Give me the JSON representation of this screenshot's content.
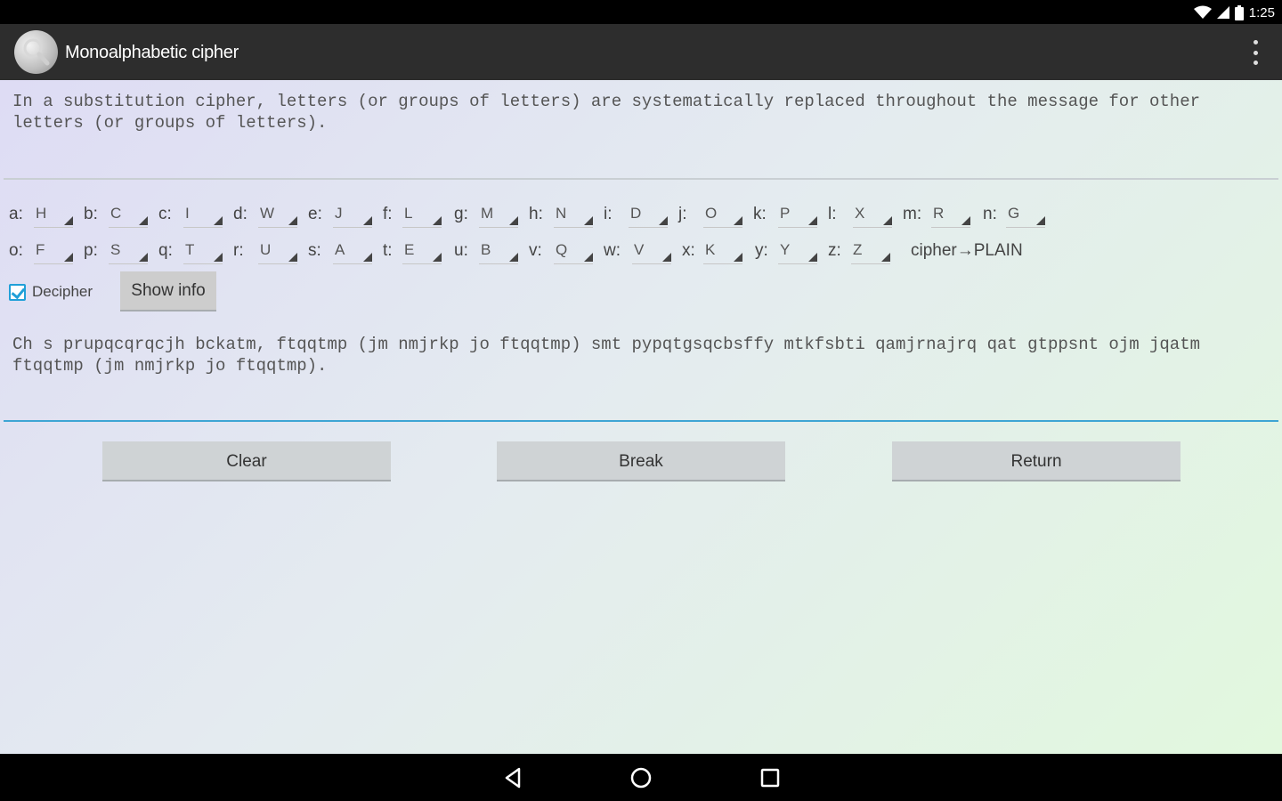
{
  "status_bar": {
    "time": "1:25"
  },
  "app": {
    "title": "Monoalphabetic cipher"
  },
  "info_text": "In a substitution cipher, letters (or groups of letters) are systematically replaced throughout the message for other letters (or groups of letters).",
  "mapping": {
    "row1": [
      {
        "letter": "a:",
        "value": "H"
      },
      {
        "letter": "b:",
        "value": "C"
      },
      {
        "letter": "c:",
        "value": "I"
      },
      {
        "letter": "d:",
        "value": "W"
      },
      {
        "letter": "e:",
        "value": "J"
      },
      {
        "letter": "f:",
        "value": "L"
      },
      {
        "letter": "g:",
        "value": "M"
      },
      {
        "letter": "h:",
        "value": "N"
      },
      {
        "letter": "i:",
        "value": "D"
      },
      {
        "letter": "j:",
        "value": "O"
      },
      {
        "letter": "k:",
        "value": "P"
      },
      {
        "letter": "l:",
        "value": "X"
      },
      {
        "letter": "m:",
        "value": "R"
      },
      {
        "letter": "n:",
        "value": "G"
      }
    ],
    "row2": [
      {
        "letter": "o:",
        "value": "F"
      },
      {
        "letter": "p:",
        "value": "S"
      },
      {
        "letter": "q:",
        "value": "T"
      },
      {
        "letter": "r:",
        "value": "U"
      },
      {
        "letter": "s:",
        "value": "A"
      },
      {
        "letter": "t:",
        "value": "E"
      },
      {
        "letter": "u:",
        "value": "B"
      },
      {
        "letter": "v:",
        "value": "Q"
      },
      {
        "letter": "w:",
        "value": "V"
      },
      {
        "letter": "x:",
        "value": "K"
      },
      {
        "letter": "y:",
        "value": "Y"
      },
      {
        "letter": "z:",
        "value": "Z"
      }
    ],
    "direction": "cipher→PLAIN"
  },
  "decipher": {
    "label": "Decipher",
    "checked": true
  },
  "buttons": {
    "show_info": "Show info",
    "clear": "Clear",
    "break": "Break",
    "return": "Return"
  },
  "cipher_text": "Ch s prupqcqrqcjh bckatm, ftqqtmp (jm nmjrkp jo ftqqtmp) smt pypqtgsqcbsffy mtkfsbti qamjrnajrq qat gtppsnt ojm jqatm ftqqtmp (jm nmjrkp jo ftqqtmp).",
  "icons": {
    "wifi": "wifi-icon",
    "signal": "signal-icon",
    "battery": "battery-icon",
    "app": "magnifier-icon",
    "menu": "overflow-menu-icon",
    "back": "back-icon",
    "home": "home-icon",
    "recents": "recents-icon"
  },
  "colors": {
    "accent": "#21a0d8",
    "action_bar": "#2d2d2d",
    "button": "#cfd3d5"
  }
}
